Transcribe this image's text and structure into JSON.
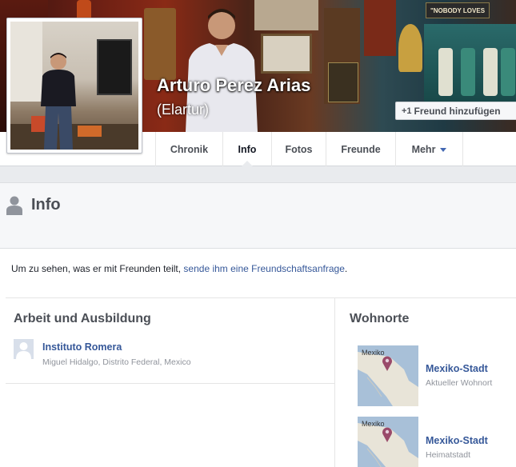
{
  "profile": {
    "name": "Arturo Perez Arias",
    "alias": "(Elartur)",
    "add_friend_label": "Freund hinzufügen",
    "add_friend_icon": "+1"
  },
  "cover": {
    "sign_text": "\"NOBODY LOVES"
  },
  "nav": {
    "tabs": [
      {
        "label": "Chronik"
      },
      {
        "label": "Info"
      },
      {
        "label": "Fotos"
      },
      {
        "label": "Freunde"
      },
      {
        "label": "Mehr"
      }
    ],
    "active": "Info"
  },
  "info": {
    "title": "Info",
    "request_prefix": "Um zu sehen, was er mit Freunden teilt, ",
    "request_link": "sende ihm eine Freundschaftsanfrage",
    "request_suffix": "."
  },
  "work": {
    "title": "Arbeit und Ausbildung",
    "items": [
      {
        "name": "Instituto Romera",
        "location": "Miguel Hidalgo, Distrito Federal, Mexico"
      }
    ]
  },
  "places": {
    "title": "Wohnorte",
    "items": [
      {
        "name": "Mexiko-Stadt",
        "type": "Aktueller Wohnort",
        "map_label": "Mexiko"
      },
      {
        "name": "Mexiko-Stadt",
        "type": "Heimatstadt",
        "map_label": "Mexiko"
      }
    ]
  },
  "colors": {
    "link": "#365899",
    "accent": "#4267b2",
    "pin": "#9a4a6a"
  }
}
